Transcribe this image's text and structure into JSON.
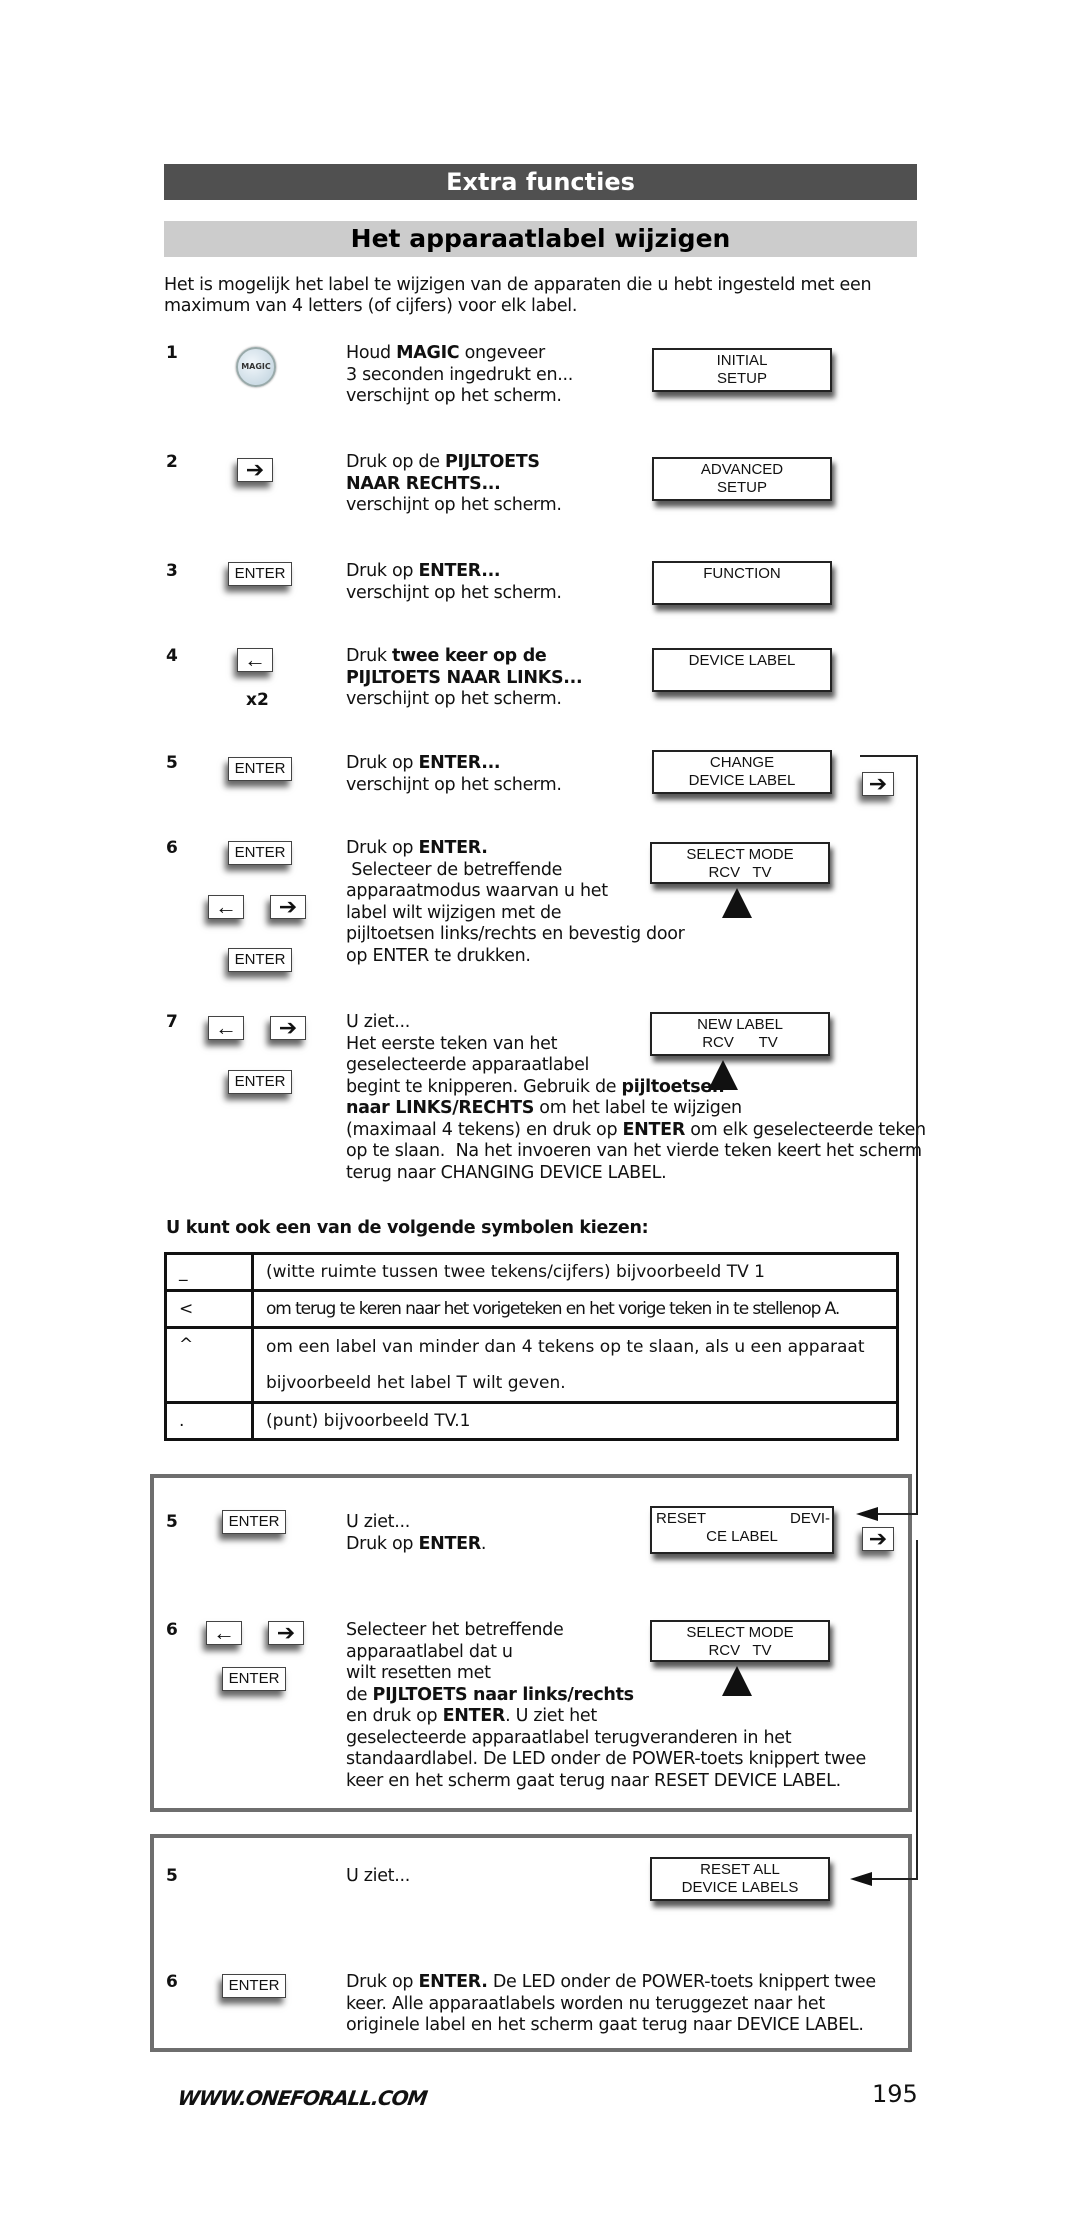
{
  "header": {
    "section_title": "Extra functies",
    "page_title": "Het apparaatlabel wijzigen"
  },
  "intro": "Het is mogelijk het label te wijzigen van de apparaten die u hebt ingesteld met een maximum van 4 letters (of cijfers) voor elk label.",
  "keys": {
    "magic": "MAGIC",
    "enter": "ENTER",
    "arrow_right": "➔",
    "arrow_left": "←",
    "times_two": "x2"
  },
  "steps": [
    {
      "number": "1",
      "lines": [
        "Houd <b>MAGIC</b> ongeveer",
        "3 seconden ingedrukt en...",
        "verschijnt op het scherm."
      ],
      "screen": [
        "INITIAL",
        "SETUP"
      ]
    },
    {
      "number": "2",
      "lines": [
        "Druk op de <b>PIJLTOETS</b>",
        "<b>NAAR RECHTS...</b>",
        "verschijnt op het scherm."
      ],
      "screen": [
        "ADVANCED",
        "SETUP"
      ]
    },
    {
      "number": "3",
      "lines": [
        "Druk op <b>ENTER...</b>",
        "verschijnt op het scherm."
      ],
      "screen": [
        "FUNCTION"
      ]
    },
    {
      "number": "4",
      "lines": [
        "Druk <b>twee keer op de</b>",
        "<b>PIJLTOETS NAAR LINKS...</b>",
        "verschijnt op het scherm."
      ],
      "screen": [
        "DEVICE LABEL"
      ]
    },
    {
      "number": "5",
      "lines": [
        "Druk op <b>ENTER...</b>",
        "verschijnt op het scherm."
      ],
      "screen": [
        "CHANGE",
        "DEVICE LABEL"
      ]
    },
    {
      "number": "6",
      "lines": [
        "Druk op <b>ENTER.</b>",
        " Selecteer de betreffende",
        "apparaatmodus waarvan u het",
        "label wilt wijzigen met de",
        "pijltoetsen links/rechts en bevestig door",
        "op ENTER te drukken."
      ],
      "screen": [
        "SELECT MODE",
        "RCV   TV"
      ]
    },
    {
      "number": "7",
      "lines": [
        "U ziet...",
        "Het eerste teken van het",
        "geselecteerde apparaatlabel",
        "begint te knipperen. Gebruik de <b>pijltoetsen</b>",
        "<b>naar LINKS/RECHTS</b> om het label te wijzigen",
        "(maximaal 4 tekens) en druk op <b>ENTER</b> om elk geselecteerde teken",
        "op te slaan.  Na het invoeren van het vierde teken keert het scherm",
        "terug naar CHANGING DEVICE LABEL."
      ],
      "screen": [
        "NEW LABEL",
        "RCV      TV"
      ]
    }
  ],
  "symbols": {
    "heading": "U kunt ook een van de volgende symbolen kiezen:",
    "rows": [
      {
        "symbol": "_",
        "description": "(witte ruimte tussen twee tekens/cijfers) bijvoorbeeld  TV 1"
      },
      {
        "symbol": "<",
        "description": "om terug te keren naar het vorigeteken en het vorige teken in te stellenop A."
      },
      {
        "symbol": "^",
        "description": "om een label van minder dan 4 tekens op te slaan, als u een apparaat bijvoorbeeld het label T wilt geven."
      },
      {
        "symbol": ".",
        "description": "(punt) bijvoorbeeld  TV.1"
      }
    ]
  },
  "reset_device": {
    "steps": [
      {
        "number": "5",
        "lines": [
          "U ziet...",
          "Druk op <b>ENTER</b>."
        ],
        "screen_left": "RESET",
        "screen_right": "DEVI-",
        "screen_line2": "CE LABEL"
      },
      {
        "number": "6",
        "lines": [
          "Selecteer het betreffende",
          "apparaatlabel dat u",
          "wilt resetten met",
          "de <b>PIJLTOETS naar links/rechts</b>",
          "en druk op <b>ENTER</b>. U ziet het",
          "geselecteerde apparaatlabel terugveranderen in het",
          "standaardlabel. De LED onder de POWER-toets knippert twee",
          "keer en het scherm gaat terug naar RESET DEVICE LABEL."
        ],
        "screen": [
          "SELECT MODE",
          "RCV   TV"
        ]
      }
    ]
  },
  "reset_all": {
    "steps": [
      {
        "number": "5",
        "lines": [
          "U ziet..."
        ],
        "screen": [
          "RESET ALL",
          "DEVICE LABELS"
        ]
      },
      {
        "number": "6",
        "lines": [
          "Druk op <b>ENTER.</b> De LED onder de POWER-toets knippert twee",
          "keer. Alle apparaatlabels worden nu teruggezet naar het",
          "originele label en het scherm gaat terug naar DEVICE LABEL."
        ]
      }
    ]
  },
  "footer": {
    "url": "WWW.ONEFORALL.COM",
    "page_number": "195"
  }
}
